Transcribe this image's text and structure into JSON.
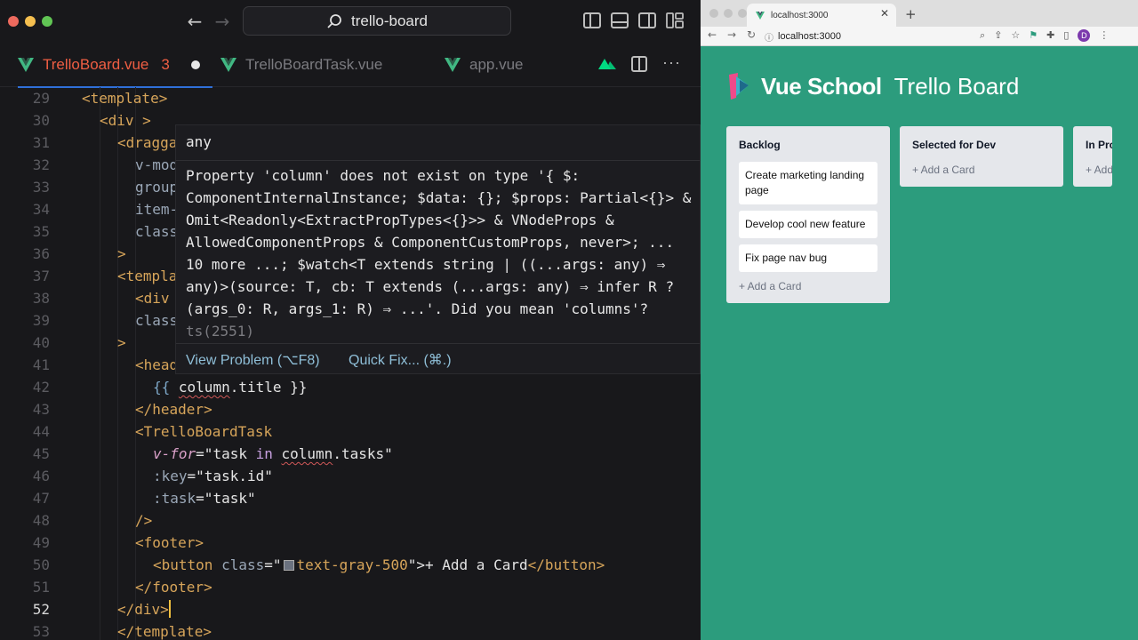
{
  "editor": {
    "search": "trello-board",
    "tabs": [
      {
        "label": "TrelloBoard.vue",
        "badge": "3",
        "active": true
      },
      {
        "label": "TrelloBoardTask.vue",
        "active": false
      },
      {
        "label": "app.vue",
        "active": false
      }
    ],
    "line_numbers": [
      "29",
      "30",
      "31",
      "32",
      "33",
      "34",
      "35",
      "36",
      "37",
      "38",
      "39",
      "40",
      "41",
      "42",
      "43",
      "44",
      "45",
      "46",
      "47",
      "48",
      "49",
      "50",
      "51",
      "52",
      "53"
    ],
    "current_line": "52",
    "code": {
      "l29": "<template>",
      "l30": "<div >",
      "l31": "<dragga",
      "l32": "v-mod",
      "l33": "group",
      "l34": "item-",
      "l35": "class",
      "l36": ">",
      "l37": "<templa",
      "l38": "<div",
      "l39": "class",
      "l40": ">",
      "l41": "<head",
      "l42_open": "{{ ",
      "l42_expr": "column",
      "l42_rest": ".title }}",
      "l43": "</header>",
      "l44_tag": "<TrelloBoardTask",
      "l45_attr": "v-for",
      "l45_eq": "=\"",
      "l45_a": "task ",
      "l45_in": "in",
      "l45_b": " ",
      "l45_col": "column",
      "l45_c": ".tasks\"",
      "l46_attr": ":key",
      "l46_val": "=\"task.id\"",
      "l47_attr": ":task",
      "l47_val": "=\"task\"",
      "l48": "/>",
      "l49": "<footer>",
      "l50_open": "<button ",
      "l50_attr": "class",
      "l50_eq": "=\"",
      "l50_cls": "text-gray-500",
      "l50_close": "\">",
      "l50_text": "+ Add a Card",
      "l50_end": "</button>",
      "l51": "</footer>",
      "l52": "</div>",
      "l53": "</template>"
    },
    "hover": {
      "type": "any",
      "message": "Property 'column' does not exist on type '{ $: ComponentInternalInstance; $data: {}; $props: Partial<{}> & Omit<Readonly<ExtractPropTypes<{}>> & VNodeProps & AllowedComponentProps & ComponentCustomProps, never>; ... 10 more ...; $watch<T extends string | ((...args: any) ⇒ any)>(source: T, cb: T extends (...args: any) ⇒ infer R ? (args_0: R, args_1: R) ⇒ ...'. Did you mean 'columns'? ",
      "code": "ts(2551)",
      "view_problem": "View Problem (⌥F8)",
      "quick_fix": "Quick Fix... (⌘.)"
    }
  },
  "browser": {
    "tab_title": "localhost:3000",
    "url": "localhost:3000",
    "avatar_letter": "D",
    "brand": "Vue School",
    "board_title": "Trello Board",
    "columns": [
      {
        "title": "Backlog",
        "cards": [
          "Create marketing landing page",
          "Develop cool new feature",
          "Fix page nav bug"
        ],
        "add": "+ Add a Card"
      },
      {
        "title": "Selected for Dev",
        "cards": [],
        "add": "+ Add a Card"
      },
      {
        "title": "In Pro",
        "cards": [],
        "add": "+ Add"
      }
    ]
  },
  "colors": {
    "board_bg": "#2c9c7d",
    "active_tab": "#ef5e43",
    "error_squiggle": "#d05858"
  }
}
